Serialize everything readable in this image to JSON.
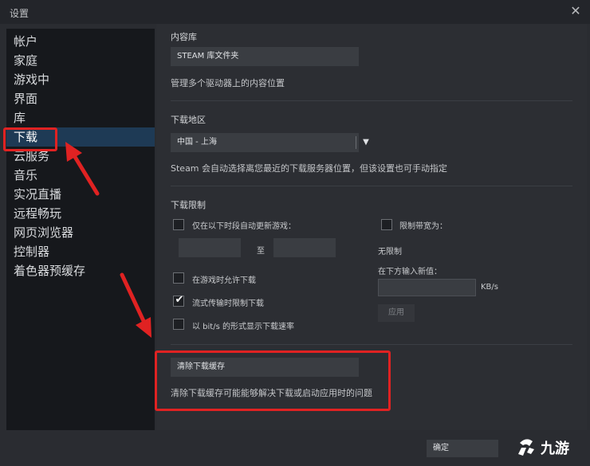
{
  "window": {
    "title": "设置",
    "close_glyph": "✕"
  },
  "sidebar": {
    "items": [
      {
        "label": "帐户"
      },
      {
        "label": "家庭"
      },
      {
        "label": "游戏中"
      },
      {
        "label": "界面"
      },
      {
        "label": "库"
      },
      {
        "label": "下载",
        "selected": true
      },
      {
        "label": "云服务"
      },
      {
        "label": "音乐"
      },
      {
        "label": "实况直播"
      },
      {
        "label": "远程畅玩"
      },
      {
        "label": "网页浏览器"
      },
      {
        "label": "控制器"
      },
      {
        "label": "着色器预缓存"
      }
    ]
  },
  "content_library": {
    "heading": "内容库",
    "button_label": "STEAM 库文件夹",
    "description": "管理多个驱动器上的内容位置"
  },
  "download_region": {
    "heading": "下载地区",
    "selected": "中国 - 上海",
    "description": "Steam 会自动选择离您最近的下载服务器位置，但该设置也可手动指定"
  },
  "download_limits": {
    "heading": "下载限制",
    "schedule_label": "仅在以下时段自动更新游戏：",
    "schedule_checked": false,
    "to_label": "至",
    "allow_ingame_label": "在游戏时允许下载",
    "allow_ingame_checked": false,
    "throttle_streaming_label": "流式传输时限制下载",
    "throttle_streaming_checked": true,
    "bits_label": "以 bit/s 的形式显示下载速率",
    "bits_checked": false,
    "bandwidth_label": "限制带宽为：",
    "bandwidth_checked": false,
    "current_limit": "无限制",
    "new_value_label": "在下方输入新值：",
    "unit": "KB/s",
    "apply_label": "应用"
  },
  "clear_cache": {
    "button_label": "清除下载缓存",
    "description": "清除下载缓存可能能够解决下载或启动应用时的问题"
  },
  "footer": {
    "ok_label": "确定"
  },
  "watermark": {
    "text": "九游"
  },
  "colors": {
    "background": "#2a2c31",
    "sidebar_bg": "#16181c",
    "selected_bg": "#1e3a55",
    "annotation_red": "#e02222",
    "button_bg": "#3a3d42"
  }
}
